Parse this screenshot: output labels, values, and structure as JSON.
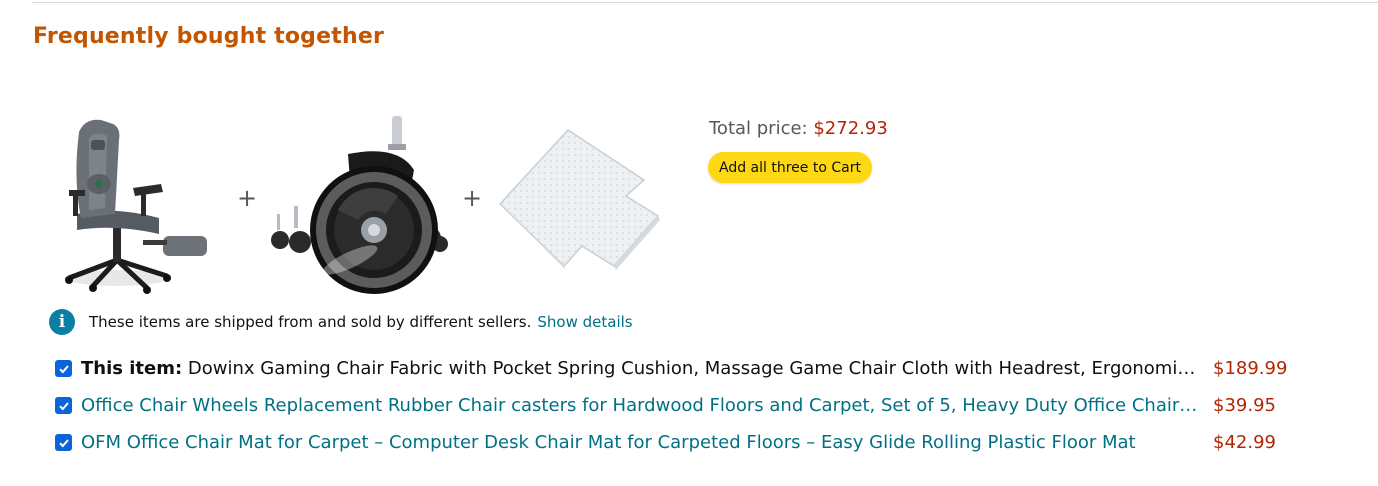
{
  "section": {
    "title": "Frequently bought together"
  },
  "products_images": [
    {
      "icon": "gaming-chair-image"
    },
    {
      "icon": "chair-caster-wheels-image"
    },
    {
      "icon": "chair-mat-image"
    }
  ],
  "separators": {
    "plus": "+"
  },
  "summary": {
    "total_label": "Total price:",
    "total_value": "$272.93",
    "add_button_label": "Add all three to Cart"
  },
  "notice": {
    "icon_glyph": "i",
    "text": "These items are shipped from and sold by different sellers.",
    "link_label": "Show details"
  },
  "items": [
    {
      "checked": true,
      "prefix": "This item:",
      "title": "Dowinx Gaming Chair Fabric with Pocket Spring Cushion, Massage Game Chair Cloth with Headrest, Ergonomic Computer Chair with Footrest",
      "price": "$189.99"
    },
    {
      "checked": true,
      "prefix": "",
      "title": "Office Chair Wheels Replacement Rubber Chair casters for Hardwood Floors and Carpet, Set of 5, Heavy Duty Office Chair Casters",
      "price": "$39.95"
    },
    {
      "checked": true,
      "prefix": "",
      "title": "OFM Office Chair Mat for Carpet – Computer Desk Chair Mat for Carpeted Floors – Easy Glide Rolling Plastic Floor Mat",
      "price": "$42.99"
    }
  ],
  "colors": {
    "title_orange": "#c45500",
    "price_red": "#b12704",
    "link_teal": "#007185",
    "button_yellow": "#ffd814",
    "checkbox_blue": "#0b65d8",
    "info_blue": "#0a7ea4"
  }
}
